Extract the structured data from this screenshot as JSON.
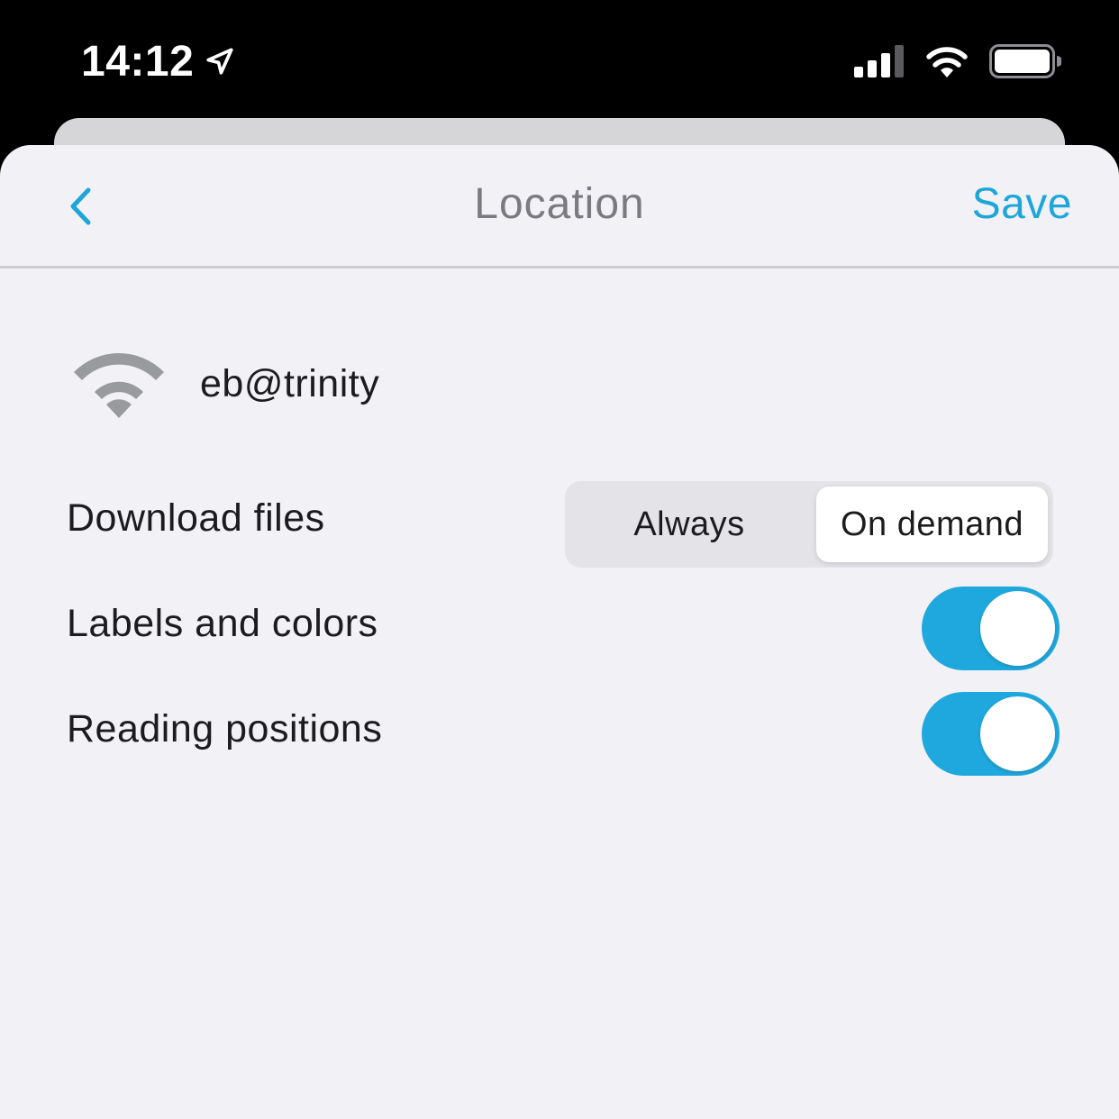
{
  "status_bar": {
    "time": "14:12",
    "location_icon": "location-arrow-icon",
    "signal_icon": "cellular-signal-icon",
    "wifi_icon": "wifi-icon",
    "battery_icon": "battery-icon"
  },
  "navbar": {
    "back_icon": "chevron-left-icon",
    "title": "Location",
    "save_label": "Save"
  },
  "account": {
    "icon": "wifi-icon",
    "name": "eb@trinity"
  },
  "settings": {
    "download_files": {
      "label": "Download files",
      "options": [
        "Always",
        "On demand"
      ],
      "selected": "On demand"
    },
    "labels_and_colors": {
      "label": "Labels and colors",
      "enabled": true
    },
    "reading_positions": {
      "label": "Reading positions",
      "enabled": true
    }
  },
  "colors": {
    "accent": "#1ea6d9",
    "toggle_on": "#1fa8de",
    "sheet_background": "#f1f1f6"
  }
}
